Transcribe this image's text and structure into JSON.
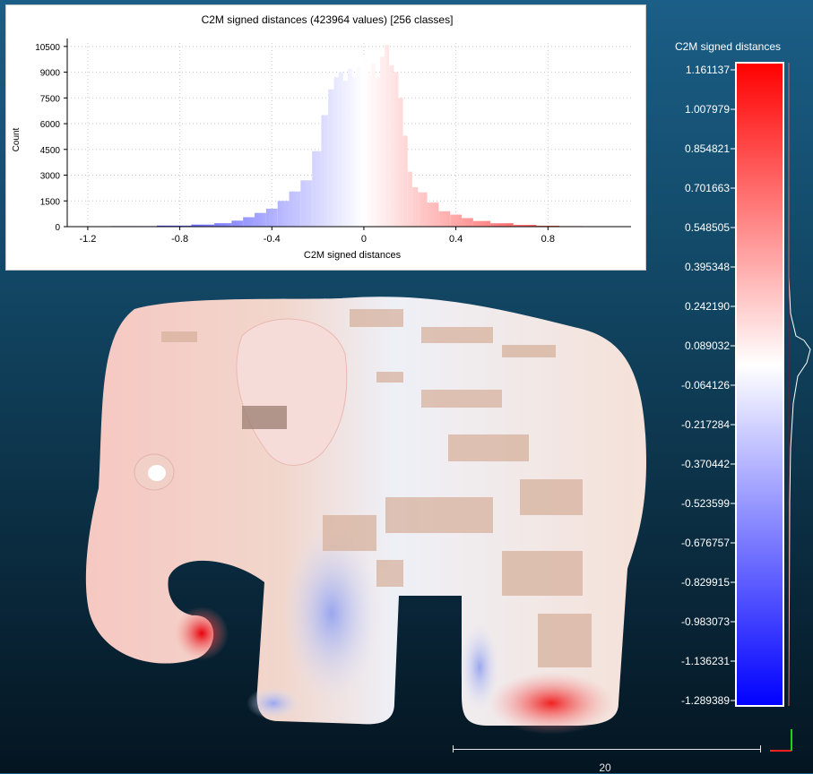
{
  "histogram": {
    "title": "C2M signed distances (423964 values)  [256 classes]",
    "xlabel": "C2M signed distances",
    "ylabel": "Count"
  },
  "chart_data": {
    "type": "bar",
    "title": "C2M signed distances (423964 values)  [256 classes]",
    "xlabel": "C2M signed distances",
    "ylabel": "Count",
    "xlim": [
      -1.289389,
      1.161137
    ],
    "ylim": [
      0,
      10700
    ],
    "x_ticks": [
      -1.2,
      -0.8,
      -0.4,
      0,
      0.4,
      0.8
    ],
    "x_tick_labels": [
      "-1.2",
      "-0.8",
      "-0.4",
      "0",
      "0.4",
      "0.8"
    ],
    "y_ticks": [
      0,
      1500,
      3000,
      4500,
      6000,
      7500,
      9000,
      10500
    ],
    "y_tick_labels": [
      "0",
      "1500",
      "3000",
      "4500",
      "6000",
      "7500",
      "9000",
      "10500"
    ],
    "grid": true,
    "bins": 256,
    "x": [
      -1.2,
      -1.0,
      -0.8,
      -0.7,
      -0.6,
      -0.55,
      -0.5,
      -0.45,
      -0.4,
      -0.35,
      -0.3,
      -0.25,
      -0.2,
      -0.17,
      -0.14,
      -0.12,
      -0.1,
      -0.08,
      -0.06,
      -0.04,
      -0.02,
      0,
      0.02,
      0.04,
      0.06,
      0.08,
      0.1,
      0.12,
      0.14,
      0.16,
      0.18,
      0.2,
      0.22,
      0.25,
      0.3,
      0.35,
      0.4,
      0.45,
      0.5,
      0.6,
      0.7,
      0.8,
      0.9,
      1.0,
      1.1
    ],
    "values": [
      10,
      30,
      60,
      120,
      200,
      350,
      550,
      800,
      1050,
      1500,
      2050,
      2700,
      4400,
      6500,
      8000,
      8700,
      9000,
      8500,
      9200,
      8700,
      9300,
      9900,
      9000,
      9500,
      8700,
      9900,
      10600,
      9400,
      9000,
      7500,
      5300,
      3200,
      2300,
      2000,
      1400,
      900,
      700,
      500,
      330,
      200,
      100,
      50,
      30,
      20,
      10
    ]
  },
  "color_scale": {
    "title": "C2M signed distances",
    "labels": [
      "1.161137",
      "1.007979",
      "0.854821",
      "0.701663",
      "0.548505",
      "0.395348",
      "0.242190",
      "0.089032",
      "-0.064126",
      "-0.217284",
      "-0.370442",
      "-0.523599",
      "-0.676757",
      "-0.829915",
      "-0.983073",
      "-1.136231",
      "-1.289389"
    ],
    "colors": {
      "high": "#ff0000",
      "mid": "#ffffff",
      "low": "#0000ff"
    }
  },
  "scale_bar": {
    "label": "20"
  }
}
